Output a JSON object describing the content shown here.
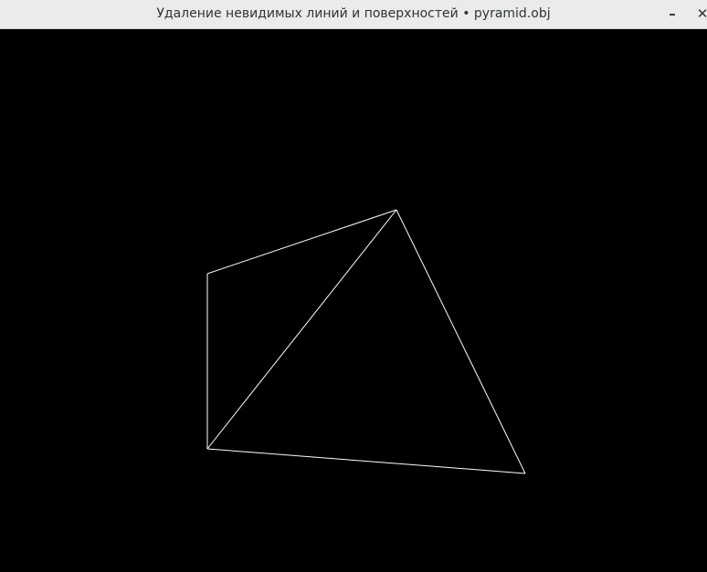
{
  "window": {
    "title": "Удаление невидимых линий и поверхностей • pyramid.obj",
    "minimize_label": "–",
    "close_label": "✕"
  },
  "viewport": {
    "background_color": "#000000",
    "line_color": "#ffffff",
    "model": "pyramid.obj"
  }
}
